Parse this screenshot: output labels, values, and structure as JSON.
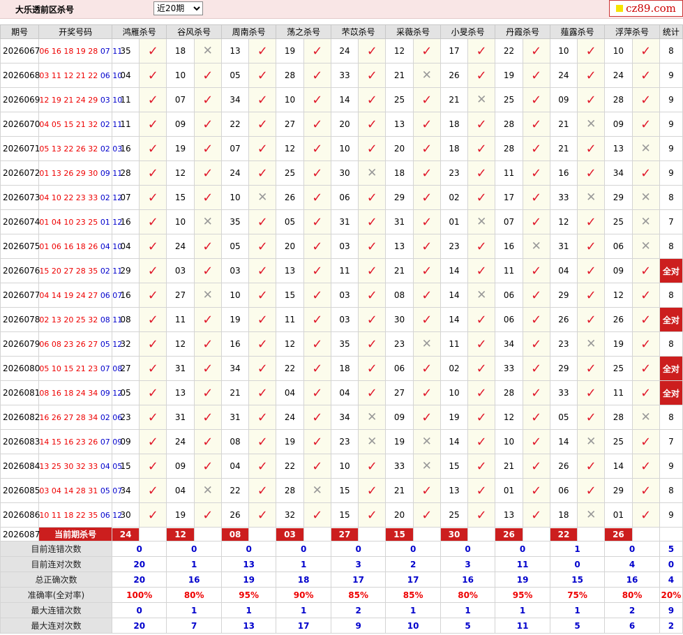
{
  "header": {
    "title": "大乐透前区杀号",
    "period_select": "近20期",
    "logo_text": "cz89.com"
  },
  "columns": [
    "期号",
    "开奖号码",
    "鸿雁杀号",
    "谷风杀号",
    "周南杀号",
    "荡之杀号",
    "芣苡杀号",
    "采薇杀号",
    "小旻杀号",
    "丹霞杀号",
    "薤露杀号",
    "浮萍杀号",
    "统计"
  ],
  "rows": [
    {
      "issue": "2026067",
      "red": "06 16 18 19 28",
      "blue": "07 11",
      "kills": [
        "35",
        "18",
        "13",
        "19",
        "24",
        "12",
        "17",
        "22",
        "10",
        "10"
      ],
      "marks": "1011111111",
      "total": "8"
    },
    {
      "issue": "2026068",
      "red": "03 11 12 21 22",
      "blue": "06 10",
      "kills": [
        "04",
        "10",
        "05",
        "28",
        "33",
        "21",
        "26",
        "19",
        "24",
        "24"
      ],
      "marks": "1111101111",
      "total": "9"
    },
    {
      "issue": "2026069",
      "red": "12 19 21 24 29",
      "blue": "03 10",
      "kills": [
        "11",
        "07",
        "34",
        "10",
        "14",
        "25",
        "21",
        "25",
        "09",
        "28"
      ],
      "marks": "1111110111",
      "total": "9"
    },
    {
      "issue": "2026070",
      "red": "04 05 15 21 32",
      "blue": "02 11",
      "kills": [
        "11",
        "09",
        "22",
        "27",
        "20",
        "13",
        "18",
        "28",
        "21",
        "09"
      ],
      "marks": "1111111101",
      "total": "9"
    },
    {
      "issue": "2026071",
      "red": "05 13 22 26 32",
      "blue": "02 03",
      "kills": [
        "16",
        "19",
        "07",
        "12",
        "10",
        "20",
        "18",
        "28",
        "21",
        "13"
      ],
      "marks": "1111111110",
      "total": "9"
    },
    {
      "issue": "2026072",
      "red": "01 13 26 29 30",
      "blue": "09 11",
      "kills": [
        "28",
        "12",
        "24",
        "25",
        "30",
        "18",
        "23",
        "11",
        "16",
        "34"
      ],
      "marks": "1111011111",
      "total": "9"
    },
    {
      "issue": "2026073",
      "red": "04 10 22 23 33",
      "blue": "02 12",
      "kills": [
        "07",
        "15",
        "10",
        "26",
        "06",
        "29",
        "02",
        "17",
        "33",
        "29"
      ],
      "marks": "1101111100",
      "total": "8"
    },
    {
      "issue": "2026074",
      "red": "01 04 10 23 25",
      "blue": "01 12",
      "kills": [
        "16",
        "10",
        "35",
        "05",
        "31",
        "31",
        "01",
        "07",
        "12",
        "25"
      ],
      "marks": "1011110110",
      "total": "7"
    },
    {
      "issue": "2026075",
      "red": "01 06 16 18 26",
      "blue": "04 10",
      "kills": [
        "04",
        "24",
        "05",
        "20",
        "03",
        "13",
        "23",
        "16",
        "31",
        "06"
      ],
      "marks": "1111111010",
      "total": "8"
    },
    {
      "issue": "2026076",
      "red": "15 20 27 28 35",
      "blue": "02 11",
      "kills": [
        "29",
        "03",
        "03",
        "13",
        "11",
        "21",
        "14",
        "11",
        "04",
        "09"
      ],
      "marks": "1111111111",
      "total": "全对"
    },
    {
      "issue": "2026077",
      "red": "04 14 19 24 27",
      "blue": "06 07",
      "kills": [
        "16",
        "27",
        "10",
        "15",
        "03",
        "08",
        "14",
        "06",
        "29",
        "12"
      ],
      "marks": "1011110111",
      "total": "8"
    },
    {
      "issue": "2026078",
      "red": "02 13 20 25 32",
      "blue": "08 11",
      "kills": [
        "08",
        "11",
        "19",
        "11",
        "03",
        "30",
        "14",
        "06",
        "26",
        "26"
      ],
      "marks": "1111111111",
      "total": "全对"
    },
    {
      "issue": "2026079",
      "red": "06 08 23 26 27",
      "blue": "05 12",
      "kills": [
        "32",
        "12",
        "16",
        "12",
        "35",
        "23",
        "11",
        "34",
        "23",
        "19"
      ],
      "marks": "1111101101",
      "total": "8"
    },
    {
      "issue": "2026080",
      "red": "05 10 15 21 23",
      "blue": "07 08",
      "kills": [
        "27",
        "31",
        "34",
        "22",
        "18",
        "06",
        "02",
        "33",
        "29",
        "25"
      ],
      "marks": "1111111111",
      "total": "全对"
    },
    {
      "issue": "2026081",
      "red": "08 16 18 24 34",
      "blue": "09 12",
      "kills": [
        "05",
        "13",
        "21",
        "04",
        "04",
        "27",
        "10",
        "28",
        "33",
        "11"
      ],
      "marks": "1111111111",
      "total": "全对"
    },
    {
      "issue": "2026082",
      "red": "16 26 27 28 34",
      "blue": "02 06",
      "kills": [
        "23",
        "31",
        "31",
        "24",
        "34",
        "09",
        "19",
        "12",
        "05",
        "28"
      ],
      "marks": "1111011110",
      "total": "8"
    },
    {
      "issue": "2026083",
      "red": "14 15 16 23 26",
      "blue": "07 09",
      "kills": [
        "09",
        "24",
        "08",
        "19",
        "23",
        "19",
        "14",
        "10",
        "14",
        "25"
      ],
      "marks": "1111001101",
      "total": "7"
    },
    {
      "issue": "2026084",
      "red": "13 25 30 32 33",
      "blue": "04 05",
      "kills": [
        "15",
        "09",
        "04",
        "22",
        "10",
        "33",
        "15",
        "21",
        "26",
        "14"
      ],
      "marks": "1111101111",
      "total": "9"
    },
    {
      "issue": "2026085",
      "red": "03 04 14 28 31",
      "blue": "05 07",
      "kills": [
        "34",
        "04",
        "22",
        "28",
        "15",
        "21",
        "13",
        "01",
        "06",
        "29"
      ],
      "marks": "1010111111",
      "total": "8"
    },
    {
      "issue": "2026086",
      "red": "10 11 18 22 35",
      "blue": "06 12",
      "kills": [
        "30",
        "19",
        "26",
        "32",
        "15",
        "20",
        "25",
        "13",
        "18",
        "01"
      ],
      "marks": "1111111101",
      "total": "9"
    }
  ],
  "current": {
    "issue": "2026087",
    "label": "当前期杀号",
    "kills": [
      "24",
      "12",
      "08",
      "03",
      "27",
      "15",
      "30",
      "26",
      "22",
      "26"
    ]
  },
  "stats": [
    {
      "label": "目前连错次数",
      "values": [
        "0",
        "0",
        "0",
        "0",
        "0",
        "0",
        "0",
        "0",
        "1",
        "0"
      ],
      "total": "5"
    },
    {
      "label": "目前连对次数",
      "values": [
        "20",
        "1",
        "13",
        "1",
        "3",
        "2",
        "3",
        "11",
        "0",
        "4"
      ],
      "total": "0"
    },
    {
      "label": "总正确次数",
      "values": [
        "20",
        "16",
        "19",
        "18",
        "17",
        "17",
        "16",
        "19",
        "15",
        "16"
      ],
      "total": "4"
    },
    {
      "label": "准确率(全对率)",
      "values": [
        "100%",
        "80%",
        "95%",
        "90%",
        "85%",
        "85%",
        "80%",
        "95%",
        "75%",
        "80%"
      ],
      "total": "20%"
    },
    {
      "label": "最大连错次数",
      "values": [
        "0",
        "1",
        "1",
        "1",
        "2",
        "1",
        "1",
        "1",
        "1",
        "2"
      ],
      "total": "9"
    },
    {
      "label": "最大连对次数",
      "values": [
        "20",
        "7",
        "13",
        "17",
        "9",
        "10",
        "5",
        "11",
        "5",
        "6"
      ],
      "total": "2"
    }
  ],
  "icons": {
    "correct": "check-icon",
    "wrong": "cross-icon"
  },
  "colors": {
    "hit": "#e0182a",
    "highlight": "#cc1e1e",
    "blue_ball": "#0000cc"
  }
}
